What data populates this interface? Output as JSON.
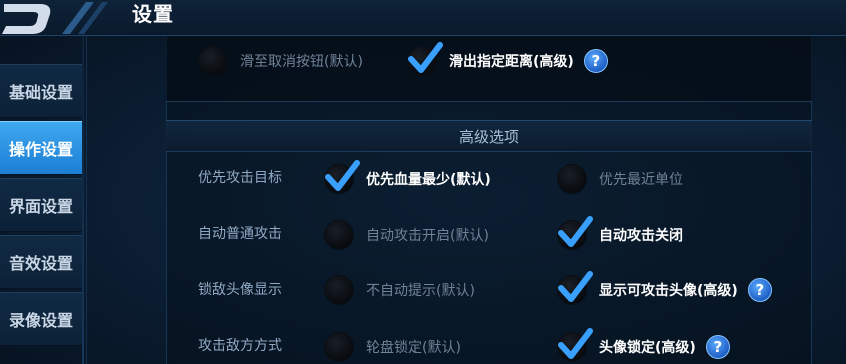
{
  "header": {
    "title": "设置"
  },
  "sidebar": {
    "items": [
      {
        "label": "基础设置",
        "active": false
      },
      {
        "label": "操作设置",
        "active": true
      },
      {
        "label": "界面设置",
        "active": false
      },
      {
        "label": "音效设置",
        "active": false
      },
      {
        "label": "录像设置",
        "active": false
      }
    ]
  },
  "top_options": [
    {
      "label": "滑至取消按钮(默认)",
      "checked": false
    },
    {
      "label": "滑出指定距离(高级)",
      "checked": true,
      "help": "?"
    }
  ],
  "advanced": {
    "header": "高级选项",
    "rows": [
      {
        "label": "优先攻击目标",
        "options": [
          {
            "label": "优先血量最少(默认)",
            "checked": true
          },
          {
            "label": "优先最近单位",
            "checked": false
          }
        ]
      },
      {
        "label": "自动普通攻击",
        "options": [
          {
            "label": "自动攻击开启(默认)",
            "checked": false
          },
          {
            "label": "自动攻击关闭",
            "checked": true
          }
        ]
      },
      {
        "label": "锁敌头像显示",
        "options": [
          {
            "label": "不自动提示(默认)",
            "checked": false
          },
          {
            "label": "显示可攻击头像(高级)",
            "checked": true,
            "help": "?"
          }
        ]
      },
      {
        "label": "攻击敌方方式",
        "options": [
          {
            "label": "轮盘锁定(默认)",
            "checked": false
          },
          {
            "label": "头像锁定(高级)",
            "checked": true,
            "help": "?"
          }
        ]
      }
    ]
  },
  "colors": {
    "accent": "#2a8fe6",
    "check": "#3aa0ff",
    "background": "#0b1d31"
  }
}
